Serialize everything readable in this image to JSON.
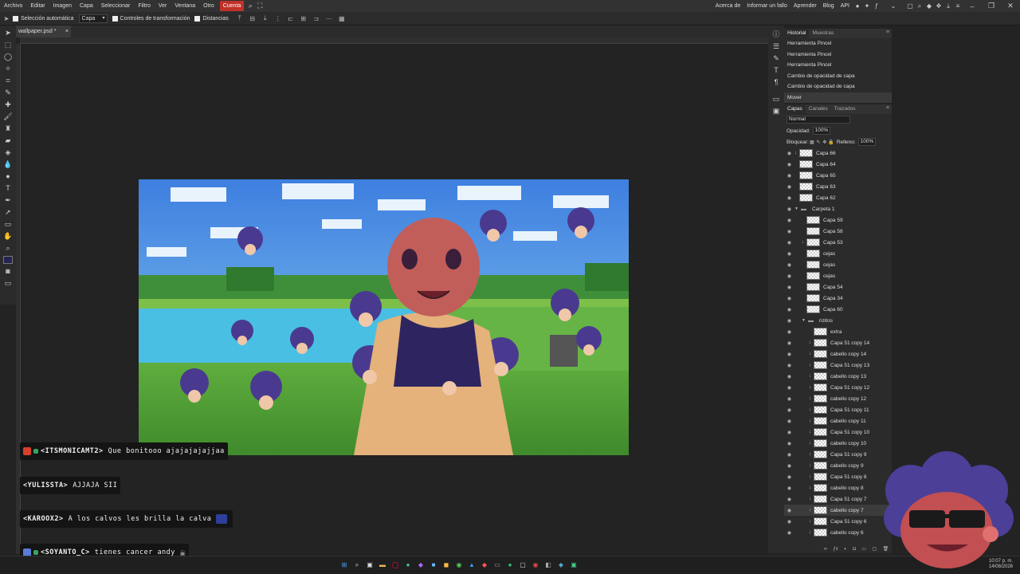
{
  "menu": {
    "items": [
      "Archivo",
      "Editar",
      "Imagen",
      "Capa",
      "Seleccionar",
      "Filtro",
      "Ver",
      "Ventana",
      "Otro"
    ],
    "active": "Cuenta",
    "right_links": [
      "Acerca de",
      "Informar un fallo",
      "Aprender",
      "Blog",
      "API"
    ]
  },
  "options": {
    "auto_select": "Selección automática",
    "target": "Capa",
    "transform_controls": "Controles de transformación",
    "distances": "Distancias"
  },
  "document": {
    "tab_title": "wallpaper.psd *",
    "close": "×"
  },
  "history": {
    "tabs": [
      "Historial",
      "Muestras"
    ],
    "items": [
      "Herramienta Pincel",
      "Herramienta Pincel",
      "Herramienta Pincel",
      "Cambio de opacidad de capa",
      "Cambio de opacidad de capa",
      "Mover"
    ]
  },
  "layers_panel": {
    "tabs": [
      "Capas",
      "Canales",
      "Trazados"
    ],
    "blend_mode": "Normal",
    "opacity_label": "Opacidad:",
    "opacity_value": "100%",
    "lock_label": "Bloquear:",
    "fill_label": "Relleno:",
    "fill_value": "100%",
    "layers": [
      {
        "name": "Capa 66",
        "indent": 0,
        "clip": true
      },
      {
        "name": "Capa 64",
        "indent": 0
      },
      {
        "name": "Capa 65",
        "indent": 0
      },
      {
        "name": "Capa 63",
        "indent": 0
      },
      {
        "name": "Capa 62",
        "indent": 0
      },
      {
        "name": "Carpeta 1",
        "indent": 0,
        "folder": true
      },
      {
        "name": "Capa 59",
        "indent": 1
      },
      {
        "name": "Capa 58",
        "indent": 1
      },
      {
        "name": "Capa 53",
        "indent": 1,
        "clip": true
      },
      {
        "name": "cejas",
        "indent": 1
      },
      {
        "name": "cejas",
        "indent": 1
      },
      {
        "name": "cejas",
        "indent": 1
      },
      {
        "name": "Capa 54",
        "indent": 1
      },
      {
        "name": "Capa 34",
        "indent": 1
      },
      {
        "name": "Capa 60",
        "indent": 1
      },
      {
        "name": "rizitos",
        "indent": 1,
        "folder": true
      },
      {
        "name": "extra",
        "indent": 2
      },
      {
        "name": "Capa 51 copy 14",
        "indent": 2,
        "clip": true
      },
      {
        "name": "cabello copy 14",
        "indent": 2,
        "clip": true
      },
      {
        "name": "Capa 51 copy 13",
        "indent": 2,
        "clip": true
      },
      {
        "name": "cabello copy 13",
        "indent": 2,
        "clip": true
      },
      {
        "name": "Capa 51 copy 12",
        "indent": 2,
        "clip": true
      },
      {
        "name": "cabello copy 12",
        "indent": 2,
        "clip": true
      },
      {
        "name": "Capa 51 copy 11",
        "indent": 2,
        "clip": true
      },
      {
        "name": "cabello copy 11",
        "indent": 2,
        "clip": true
      },
      {
        "name": "Capa 51 copy 10",
        "indent": 2,
        "clip": true
      },
      {
        "name": "cabello copy 10",
        "indent": 2,
        "clip": true
      },
      {
        "name": "Capa 51 copy 9",
        "indent": 2,
        "clip": true
      },
      {
        "name": "cabello copy 9",
        "indent": 2,
        "clip": true
      },
      {
        "name": "Capa 51 copy 8",
        "indent": 2,
        "clip": true
      },
      {
        "name": "cabello copy 8",
        "indent": 2,
        "clip": true
      },
      {
        "name": "Capa 51 copy 7",
        "indent": 2,
        "clip": true
      },
      {
        "name": "cabello copy 7",
        "indent": 2,
        "clip": true,
        "selected": true
      },
      {
        "name": "Capa 51 copy 6",
        "indent": 2,
        "clip": true
      },
      {
        "name": "cabello copy 6",
        "indent": 2,
        "clip": true
      }
    ]
  },
  "chat": [
    {
      "user": "<ITSMONICAMT2>",
      "message": "Que bonitooo ajajajajajjaa",
      "badge_color": "#d9402b"
    },
    {
      "user": "<YULISSTA>",
      "message": "AJJAJA SII",
      "badge_color": ""
    },
    {
      "user": "<KAROOX2>",
      "message": "A los calvos les brilla la calva",
      "badge_color": ""
    },
    {
      "user": "<SOYANTO_C>",
      "message": "tienes cancer andy",
      "badge_color": "#5a7bd8"
    }
  ],
  "taskbar": {
    "time": "10:07 p. m.",
    "date": "14/08/2026"
  },
  "colors": {
    "accent": "#c0312a",
    "panel": "#2b2b2b",
    "canvas_bg": "#232323"
  }
}
